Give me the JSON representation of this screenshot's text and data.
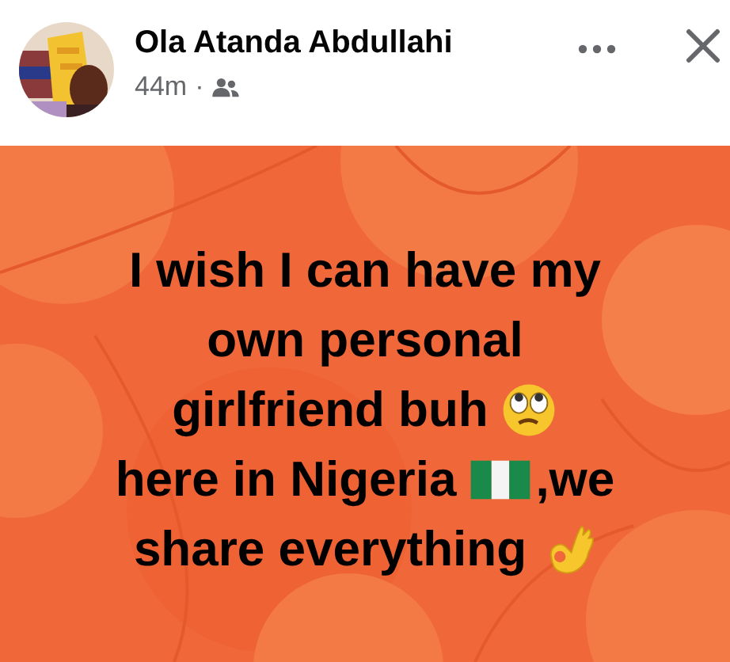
{
  "post": {
    "author": "Ola Atanda Abdullahi",
    "time": "44m",
    "separator": "·",
    "lines": [
      [
        {
          "kind": "text",
          "text": "I wish I can have my"
        }
      ],
      [
        {
          "kind": "text",
          "text": "own personal"
        }
      ],
      [
        {
          "kind": "text",
          "text": "girlfriend buh"
        },
        {
          "kind": "eyes"
        }
      ],
      [
        {
          "kind": "text",
          "text": "here in Nigeria"
        },
        {
          "kind": "flag"
        },
        {
          "kind": "text",
          "text": ",we"
        }
      ],
      [
        {
          "kind": "text",
          "text": "share everything"
        },
        {
          "kind": "okhand"
        }
      ]
    ]
  }
}
